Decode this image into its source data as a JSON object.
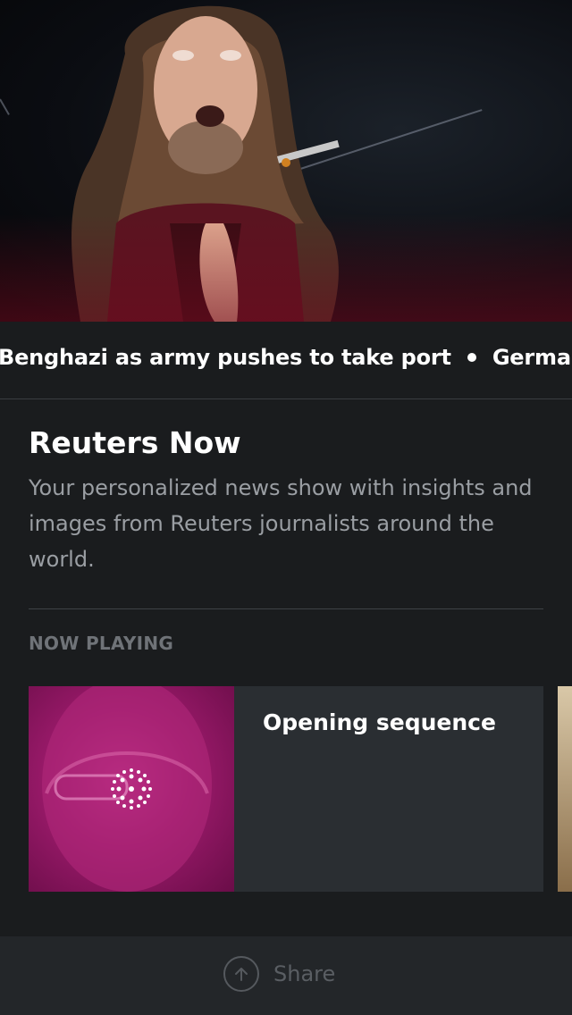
{
  "hero": {
    "image": "musician-performing-video-still"
  },
  "ticker": {
    "items": [
      "Benghazi as army pushes to take port",
      "German indu"
    ]
  },
  "show": {
    "title": "Reuters Now",
    "description": "Your personalized news show with insights and images from Reuters journalists around the world."
  },
  "now_playing": {
    "label": "NOW PLAYING",
    "card": {
      "title": "Opening sequence",
      "thumbnail": "reuters-logo-on-magenta-portrait"
    }
  },
  "bottom_bar": {
    "share_label": "Share",
    "share_icon": "arrow-up-circle-icon"
  },
  "colors": {
    "background": "#1a1c1e",
    "card": "#2a2e32",
    "muted_text": "#9a9ea3"
  }
}
